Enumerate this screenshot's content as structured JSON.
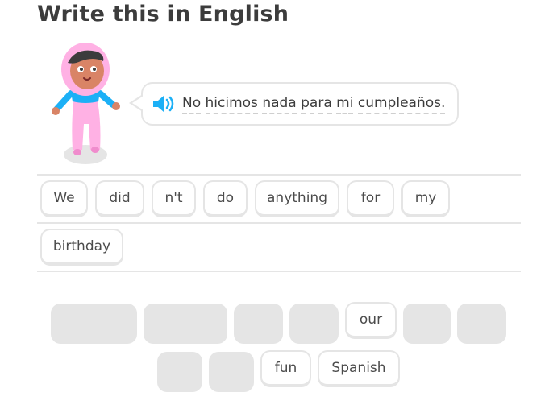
{
  "header": {
    "title": "Write this in English"
  },
  "prompt": {
    "words": [
      "No",
      "hicimos",
      "nada",
      "para",
      "mi",
      "cumpleaños."
    ]
  },
  "answer": {
    "tiles": [
      "We",
      "did",
      "n't",
      "do",
      "anything",
      "for",
      "my",
      "birthday"
    ]
  },
  "word_bank": {
    "visible_tiles": [
      "our",
      "fun",
      "Spanish"
    ]
  },
  "colors": {
    "border": "#e5e5e5",
    "speaker_blue": "#1cb0f6",
    "character_pink": "#ffb1e4",
    "character_skin": "#d98466"
  },
  "icons": {
    "speaker": "speaker-icon",
    "character": "character-illustration"
  }
}
